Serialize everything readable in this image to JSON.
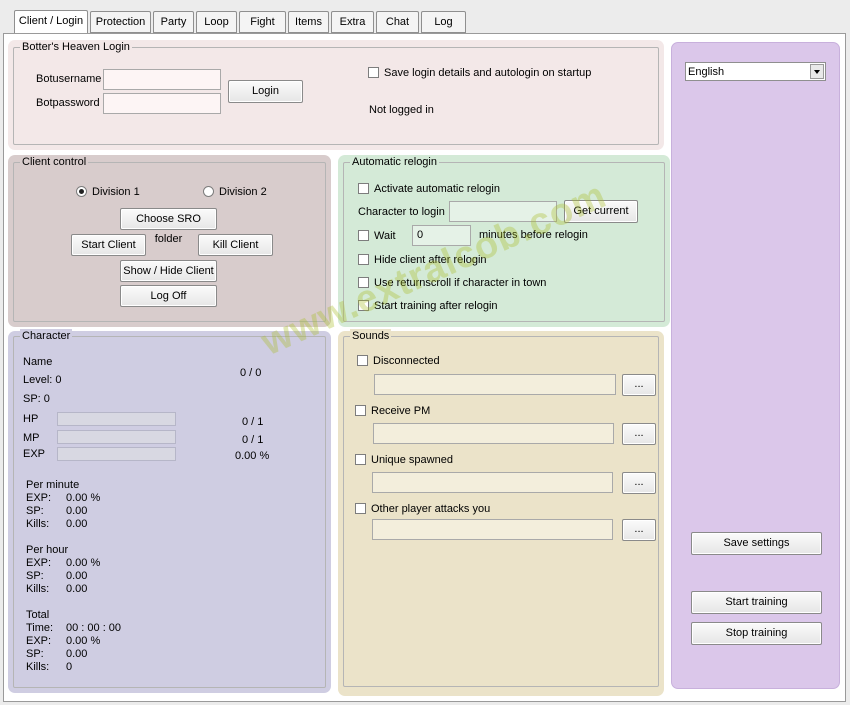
{
  "tabs": [
    {
      "label": "Client / Login",
      "active": true
    },
    {
      "label": "Protection"
    },
    {
      "label": "Party"
    },
    {
      "label": "Loop"
    },
    {
      "label": "Fight"
    },
    {
      "label": "Items"
    },
    {
      "label": "Extra"
    },
    {
      "label": "Chat"
    },
    {
      "label": "Log"
    }
  ],
  "login": {
    "legend": "Botter's Heaven Login",
    "username_label": "Botusername",
    "password_label": "Botpassword",
    "username_value": "",
    "password_value": "",
    "login_button": "Login",
    "autologin_label": "Save login details and autologin on startup",
    "autologin_checked": false,
    "status": "Not logged in"
  },
  "client_control": {
    "legend": "Client control",
    "division1": "Division 1",
    "division2": "Division 2",
    "selected_division": 1,
    "choose_folder": "Choose SRO folder",
    "start_client": "Start Client",
    "kill_client": "Kill Client",
    "show_hide": "Show / Hide Client",
    "log_off": "Log Off"
  },
  "relogin": {
    "legend": "Automatic relogin",
    "activate_label": "Activate automatic relogin",
    "character_label": "Character to login",
    "character_value": "",
    "get_current": "Get current",
    "wait_label": "Wait",
    "wait_value": "0",
    "minutes_label": "minutes before relogin",
    "hide_client_label": "Hide client after relogin",
    "returnscroll_label": "Use returnscroll if character in town",
    "start_training_label": "Start training after relogin"
  },
  "character": {
    "legend": "Character",
    "name_label": "Name",
    "level_label": "Level: 0",
    "sp_label": "SP: 0",
    "level_progress": "0 / 0",
    "hp_label": "HP",
    "mp_label": "MP",
    "exp_label": "EXP",
    "hp_value": "0 / 1",
    "mp_value": "0 / 1",
    "exp_value": "0.00 %",
    "hp_fraction": 0,
    "mp_fraction": 0,
    "exp_fraction": 0,
    "per_minute": {
      "title": "Per minute",
      "exp_label": "EXP:",
      "exp": "0.00 %",
      "sp_label": "SP:",
      "sp": "0.00",
      "kills_label": "Kills:",
      "kills": "0.00"
    },
    "per_hour": {
      "title": "Per hour",
      "exp_label": "EXP:",
      "exp": "0.00 %",
      "sp_label": "SP:",
      "sp": "0.00",
      "kills_label": "Kills:",
      "kills": "0.00"
    },
    "total": {
      "title": "Total",
      "time_label": "Time:",
      "time": "00 : 00 : 00",
      "exp_label": "EXP:",
      "exp": "0.00 %",
      "sp_label": "SP:",
      "sp": "0.00",
      "kills_label": "Kills:",
      "kills": "0"
    }
  },
  "sounds": {
    "legend": "Sounds",
    "browse": "...",
    "items": [
      {
        "label": "Disconnected",
        "path": ""
      },
      {
        "label": "Receive PM",
        "path": ""
      },
      {
        "label": "Unique spawned",
        "path": ""
      },
      {
        "label": "Other player attacks you",
        "path": ""
      }
    ]
  },
  "right": {
    "language": "English",
    "save_settings": "Save settings",
    "start_training": "Start training",
    "stop_training": "Stop training"
  },
  "watermark": "www.extralcob.com",
  "colors": {
    "login_panel": "#f3e8e8",
    "client_panel": "#d8cccc",
    "relogin_panel": "#d4ead7",
    "character_panel": "#cfcde2",
    "sounds_panel": "#ebe3c9",
    "right_panel": "#dbc7ea"
  },
  "icons": [
    "dropdown-arrow-icon",
    "radio-icon",
    "checkbox-icon"
  ]
}
